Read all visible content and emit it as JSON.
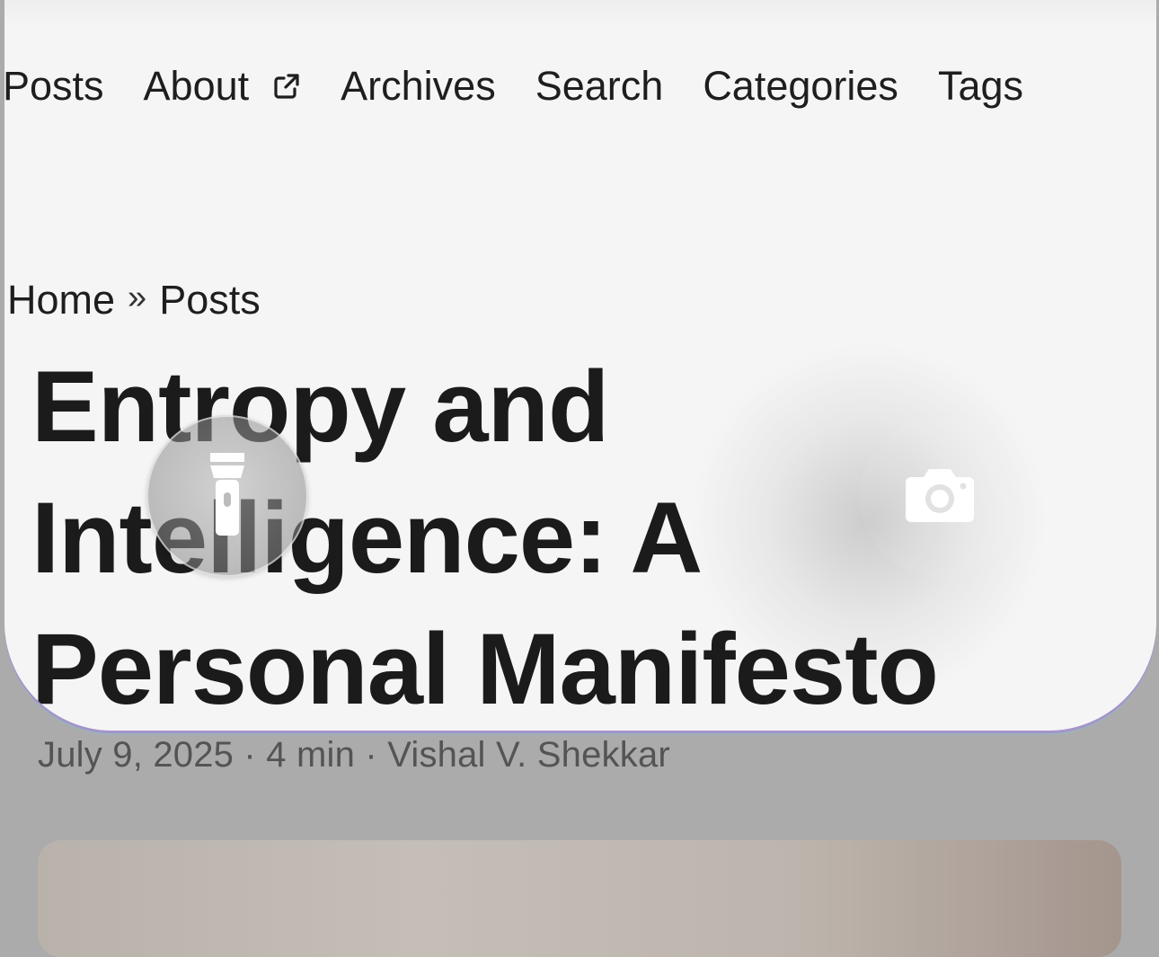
{
  "nav": {
    "items": [
      {
        "label": "Posts"
      },
      {
        "label": "About",
        "external": true
      },
      {
        "label": "Archives"
      },
      {
        "label": "Search"
      },
      {
        "label": "Categories"
      },
      {
        "label": "Tags"
      }
    ]
  },
  "breadcrumb": {
    "home": "Home",
    "separator": "»",
    "current": "Posts"
  },
  "post": {
    "title": "Entropy and Intelligence: A Personal Manifesto",
    "meta": "July 9, 2025 · 4 min · Vishal V. Shekkar"
  },
  "lockscreen": {
    "left_button_icon": "flashlight-icon",
    "right_button_icon": "camera-icon"
  },
  "colors": {
    "page_dim": "#ababab",
    "sheet": "#f5f5f5",
    "text": "#1b1b1b",
    "meta_text": "#545454"
  }
}
